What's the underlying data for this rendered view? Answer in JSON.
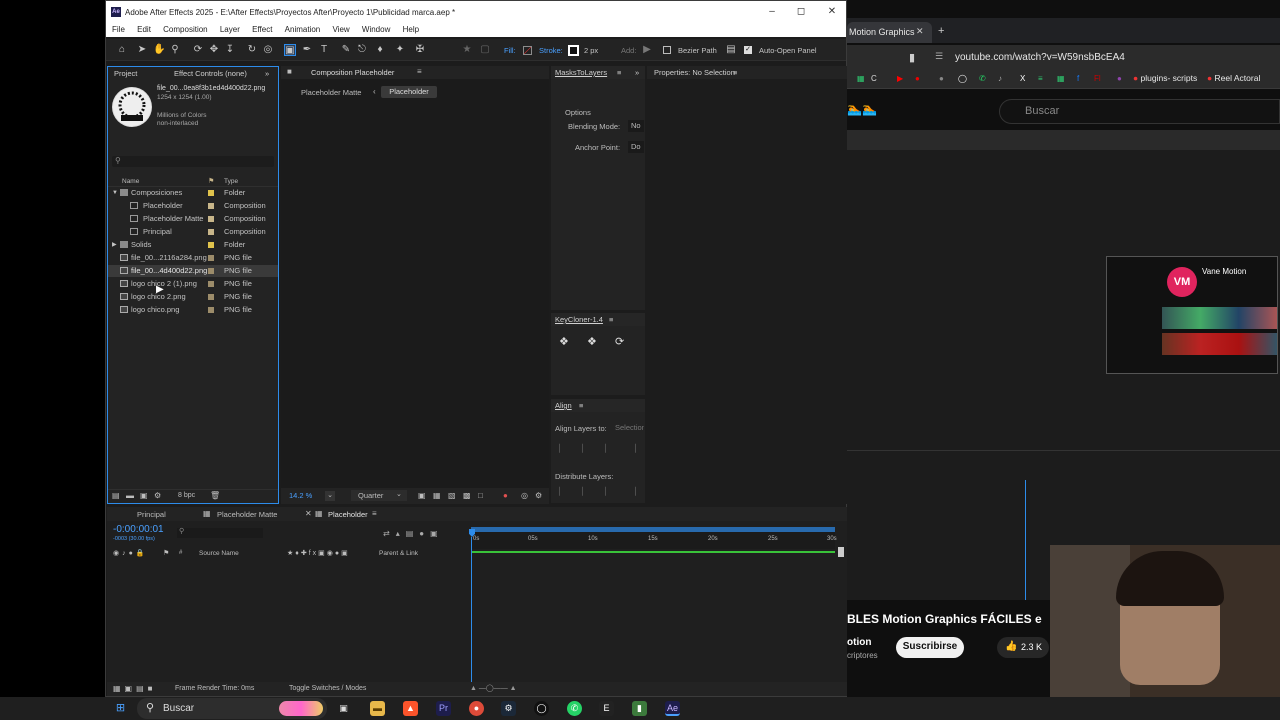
{
  "ae": {
    "title": "Adobe After Effects 2025 - E:\\After Effects\\Proyectos After\\Proyecto 1\\Publicidad marca.aep *",
    "logo": "Ae",
    "menu": [
      "File",
      "Edit",
      "Composition",
      "Layer",
      "Effect",
      "Animation",
      "View",
      "Window",
      "Help"
    ],
    "toolbar": {
      "fill": "Fill:",
      "stroke": "Stroke:",
      "stroke_width": "2 px",
      "add": "Add:",
      "bezier": "Bezier Path",
      "auto_open": "Auto-Open Panel"
    },
    "project": {
      "tab_project": "Project",
      "tab_effect_controls": "Effect Controls (none)",
      "preview_name": "file_00...0ea8f3b1ed4d400d22.png",
      "preview_dims": "1254 x 1254 (1.00)",
      "preview_colors": "Millions of Colors",
      "preview_interlace": "non-interlaced",
      "search_placeholder": "",
      "col_name": "Name",
      "col_type": "Type",
      "items": [
        {
          "name": "Composiciones",
          "type": "Folder"
        },
        {
          "name": "Placeholder",
          "type": "Composition"
        },
        {
          "name": "Placeholder Matte",
          "type": "Composition"
        },
        {
          "name": "Principal",
          "type": "Composition"
        },
        {
          "name": "Solids",
          "type": "Folder"
        },
        {
          "name": "file_00...2116a284.png",
          "type": "PNG file"
        },
        {
          "name": "file_00...4d400d22.png",
          "type": "PNG file"
        },
        {
          "name": "logo chico 2 (1).png",
          "type": "PNG file"
        },
        {
          "name": "logo chico 2.png",
          "type": "PNG file"
        },
        {
          "name": "logo chico.png",
          "type": "PNG file"
        }
      ],
      "bpc": "8 bpc"
    },
    "composition": {
      "panel_title": "Composition Placeholder",
      "crumb_1": "Placeholder Matte",
      "crumb_2": "Placeholder",
      "zoom": "14.2 %",
      "resolution": "Quarter"
    },
    "masks": {
      "title": "MasksToLayers",
      "options": "Options",
      "blending_label": "Blending Mode:",
      "blending_value": "No",
      "anchor_label": "Anchor Point:",
      "anchor_value": "Do"
    },
    "keycloner": {
      "title": "KeyCloner-1.4"
    },
    "align": {
      "title": "Align",
      "align_to": "Align Layers to:",
      "align_to_value": "Selection",
      "distribute": "Distribute Layers:"
    },
    "properties": {
      "title": "Properties: No Selection"
    },
    "timeline": {
      "tabs": [
        "Principal",
        "Placeholder Matte",
        "Placeholder"
      ],
      "timecode": "-0:00:00:01",
      "fps": "-0003 (30.00 fps)",
      "col_source": "Source Name",
      "col_parent": "Parent & Link",
      "ticks": [
        "0s",
        "05s",
        "10s",
        "15s",
        "20s",
        "25s",
        "30s"
      ],
      "render_time": "Frame Render Time: 0ms",
      "toggle": "Toggle Switches / Modes"
    }
  },
  "browser": {
    "tab_title": "Motion Graphics",
    "url": "youtube.com/watch?v=W59nsbBcEA4",
    "bookmarks": [
      "plugins- scripts",
      "Reel Actoral"
    ],
    "search_placeholder": "Buscar",
    "channel_name": "Vane Motion",
    "channel_initials": "VM",
    "video_title": "BLES Motion Graphics FÁCILES e",
    "channel_short": "otion",
    "subs": "criptores",
    "subscribe": "Suscribirse",
    "likes": "2.3 K"
  },
  "taskbar": {
    "search": "Buscar"
  },
  "colors": {
    "accent": "#2d8ceb",
    "comp_label": "#c8b68a",
    "folder_label": "#e0c34c",
    "png_label": "#9c8c6a",
    "timeline_green": "#39c239",
    "ae_purple": "#1d1d4c"
  }
}
